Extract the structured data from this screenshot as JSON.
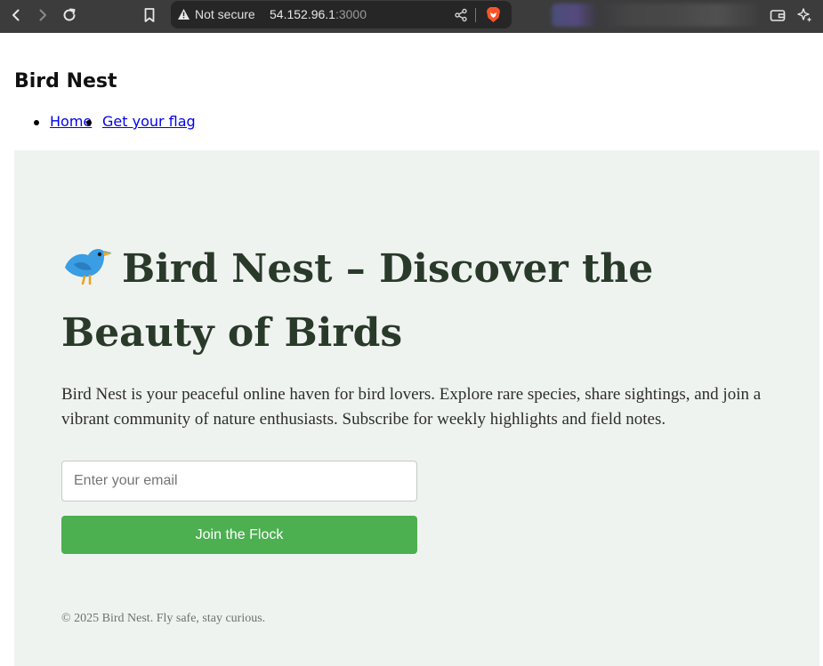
{
  "browser": {
    "security_label": "Not secure",
    "url_host": "54.152.96.1",
    "url_port": ":3000"
  },
  "site": {
    "title": "Bird Nest",
    "nav": [
      {
        "label": "Home"
      },
      {
        "label": "Get your flag"
      }
    ]
  },
  "hero": {
    "title": "Bird Nest – Discover the Beauty of Birds",
    "description": "Bird Nest is your peaceful online haven for bird lovers. Explore rare species, share sightings, and join a vibrant community of nature enthusiasts. Subscribe for weekly highlights and field notes.",
    "email_placeholder": "Enter your email",
    "email_value": "",
    "join_button": "Join the Flock"
  },
  "footer": {
    "text": "© 2025 Bird Nest. Fly safe, stay curious."
  },
  "icons": {
    "back": "chevron-left-icon",
    "forward": "chevron-right-icon",
    "reload": "reload-icon",
    "bookmark": "bookmark-icon",
    "warning": "warning-triangle-icon",
    "share": "share-icon",
    "brave": "brave-shield-icon",
    "wallet": "wallet-icon",
    "leo": "sparkle-icon",
    "hero_bird": "bird-icon"
  },
  "colors": {
    "hero_background": "#eff3f0",
    "button": "#4caf50",
    "link": "#0000ee"
  }
}
